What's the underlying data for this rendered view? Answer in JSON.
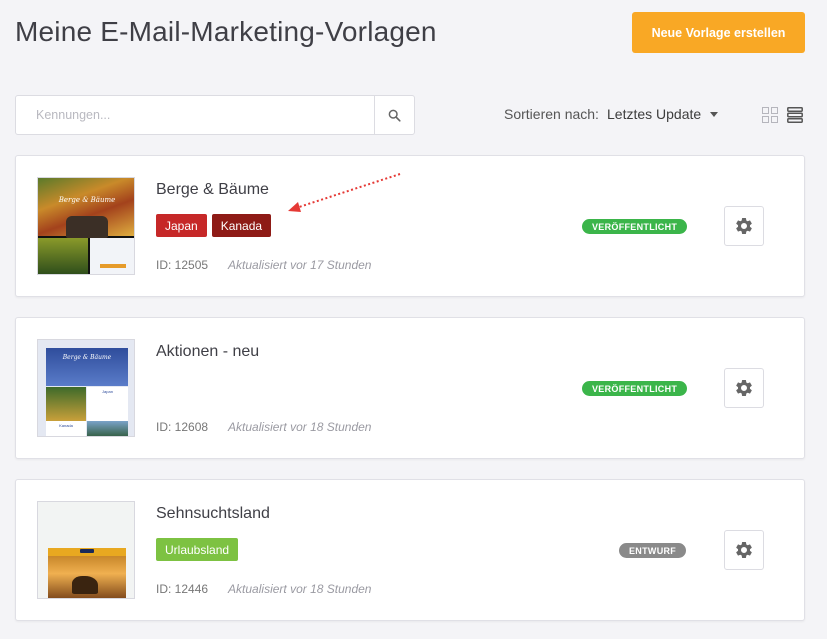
{
  "header": {
    "title": "Meine E-Mail-Marketing-Vorlagen",
    "new_button": "Neue Vorlage erstellen"
  },
  "toolbar": {
    "search_placeholder": "Kennungen...",
    "sort_label": "Sortieren nach:",
    "sort_value": "Letztes Update"
  },
  "templates": [
    {
      "title": "Berge & Bäume",
      "tags": [
        "Japan",
        "Kanada"
      ],
      "tag_colors": [
        "#c62828",
        "#8e1b16"
      ],
      "status": "VERÖFFENTLICHT",
      "status_color": "#3bb54a",
      "id_label": "ID: 12505",
      "updated": "Aktualisiert vor 17 Stunden"
    },
    {
      "title": "Aktionen - neu",
      "tags": [],
      "status": "VERÖFFENTLICHT",
      "status_color": "#3bb54a",
      "id_label": "ID: 12608",
      "updated": "Aktualisiert vor 18 Stunden"
    },
    {
      "title": "Sehnsuchtsland",
      "tags": [
        "Urlaubsland"
      ],
      "tag_colors": [
        "#7dc242"
      ],
      "status": "ENTWURF",
      "status_color": "#8a8a8a",
      "id_label": "ID: 12446",
      "updated": "Aktualisiert vor 18 Stunden"
    }
  ],
  "thumbnails": {
    "t1_title": "Berge & Bäume",
    "t2_title": "Berge & Bäume",
    "t2_sub1": "Japan",
    "t2_sub2": "Kanada"
  },
  "colors": {
    "accent": "#f9a825",
    "published": "#3bb54a",
    "draft": "#8a8a8a",
    "annotation_arrow": "#e53935"
  }
}
